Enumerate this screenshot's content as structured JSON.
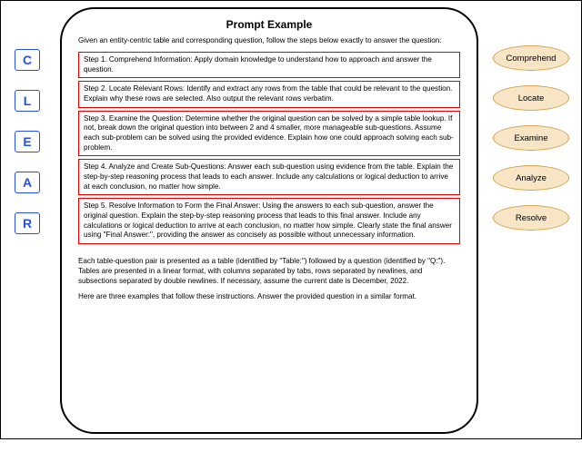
{
  "title": "Prompt Example",
  "intro": "Given an entity-centric table and corresponding question, follow the steps below exactly to answer the question:",
  "steps": {
    "s1": "Step 1. Comprehend Information: Apply domain knowledge to understand how to approach and answer the question.",
    "s2": "Step 2. Locate Relevant Rows: Identify and extract any rows from the table that could be relevant to the question. Explain why these rows are selected. Also output the relevant rows verbatim.",
    "s3": "Step 3. Examine the Question: Determine whether the original question can be solved by a simple table lookup. If not, break down the original question into between 2 and 4 smaller, more manageable sub-questions. Assume each sub-problem can be solved using the provided evidence. Explain how one could approach solving each sub-problem.",
    "s4": "Step 4. Analyze and Create Sub-Questions: Answer each sub-question using evidence from the table. Explain the step-by-step reasoning process that leads to each answer. Include any calculations or logical deduction to arrive at each conclusion, no matter how simple.",
    "s5": "Step 5. Resolve Information to Form the Final Answer: Using the answers to each sub-question, answer the original question. Explain the step-by-step reasoning process that leads to this final answer. Include any calculations or logical deduction to arrive at each conclusion, no matter how simple. Clearly state the final answer using \"Final Answer:\", providing the answer as concisely as possible without unnecessary information."
  },
  "format_note": "Each table-question pair is presented as a table (identified by \"Table:\") followed by a question (identified by \"Q:\"). Tables are presented in a linear format, with columns separated by tabs, rows separated by newlines, and subsections separated by double newlines. If necessary, assume the current date is December, 2022.",
  "closing": "Here are three examples that follow these instructions. Answer the provided question in a similar format.",
  "letters": {
    "c": "C",
    "l": "L",
    "e": "E",
    "a": "A",
    "r": "R"
  },
  "ovals": {
    "comprehend": "Comprehend",
    "locate": "Locate",
    "examine": "Examine",
    "analyze": "Analyze",
    "resolve": "Resolve"
  },
  "caption": ""
}
